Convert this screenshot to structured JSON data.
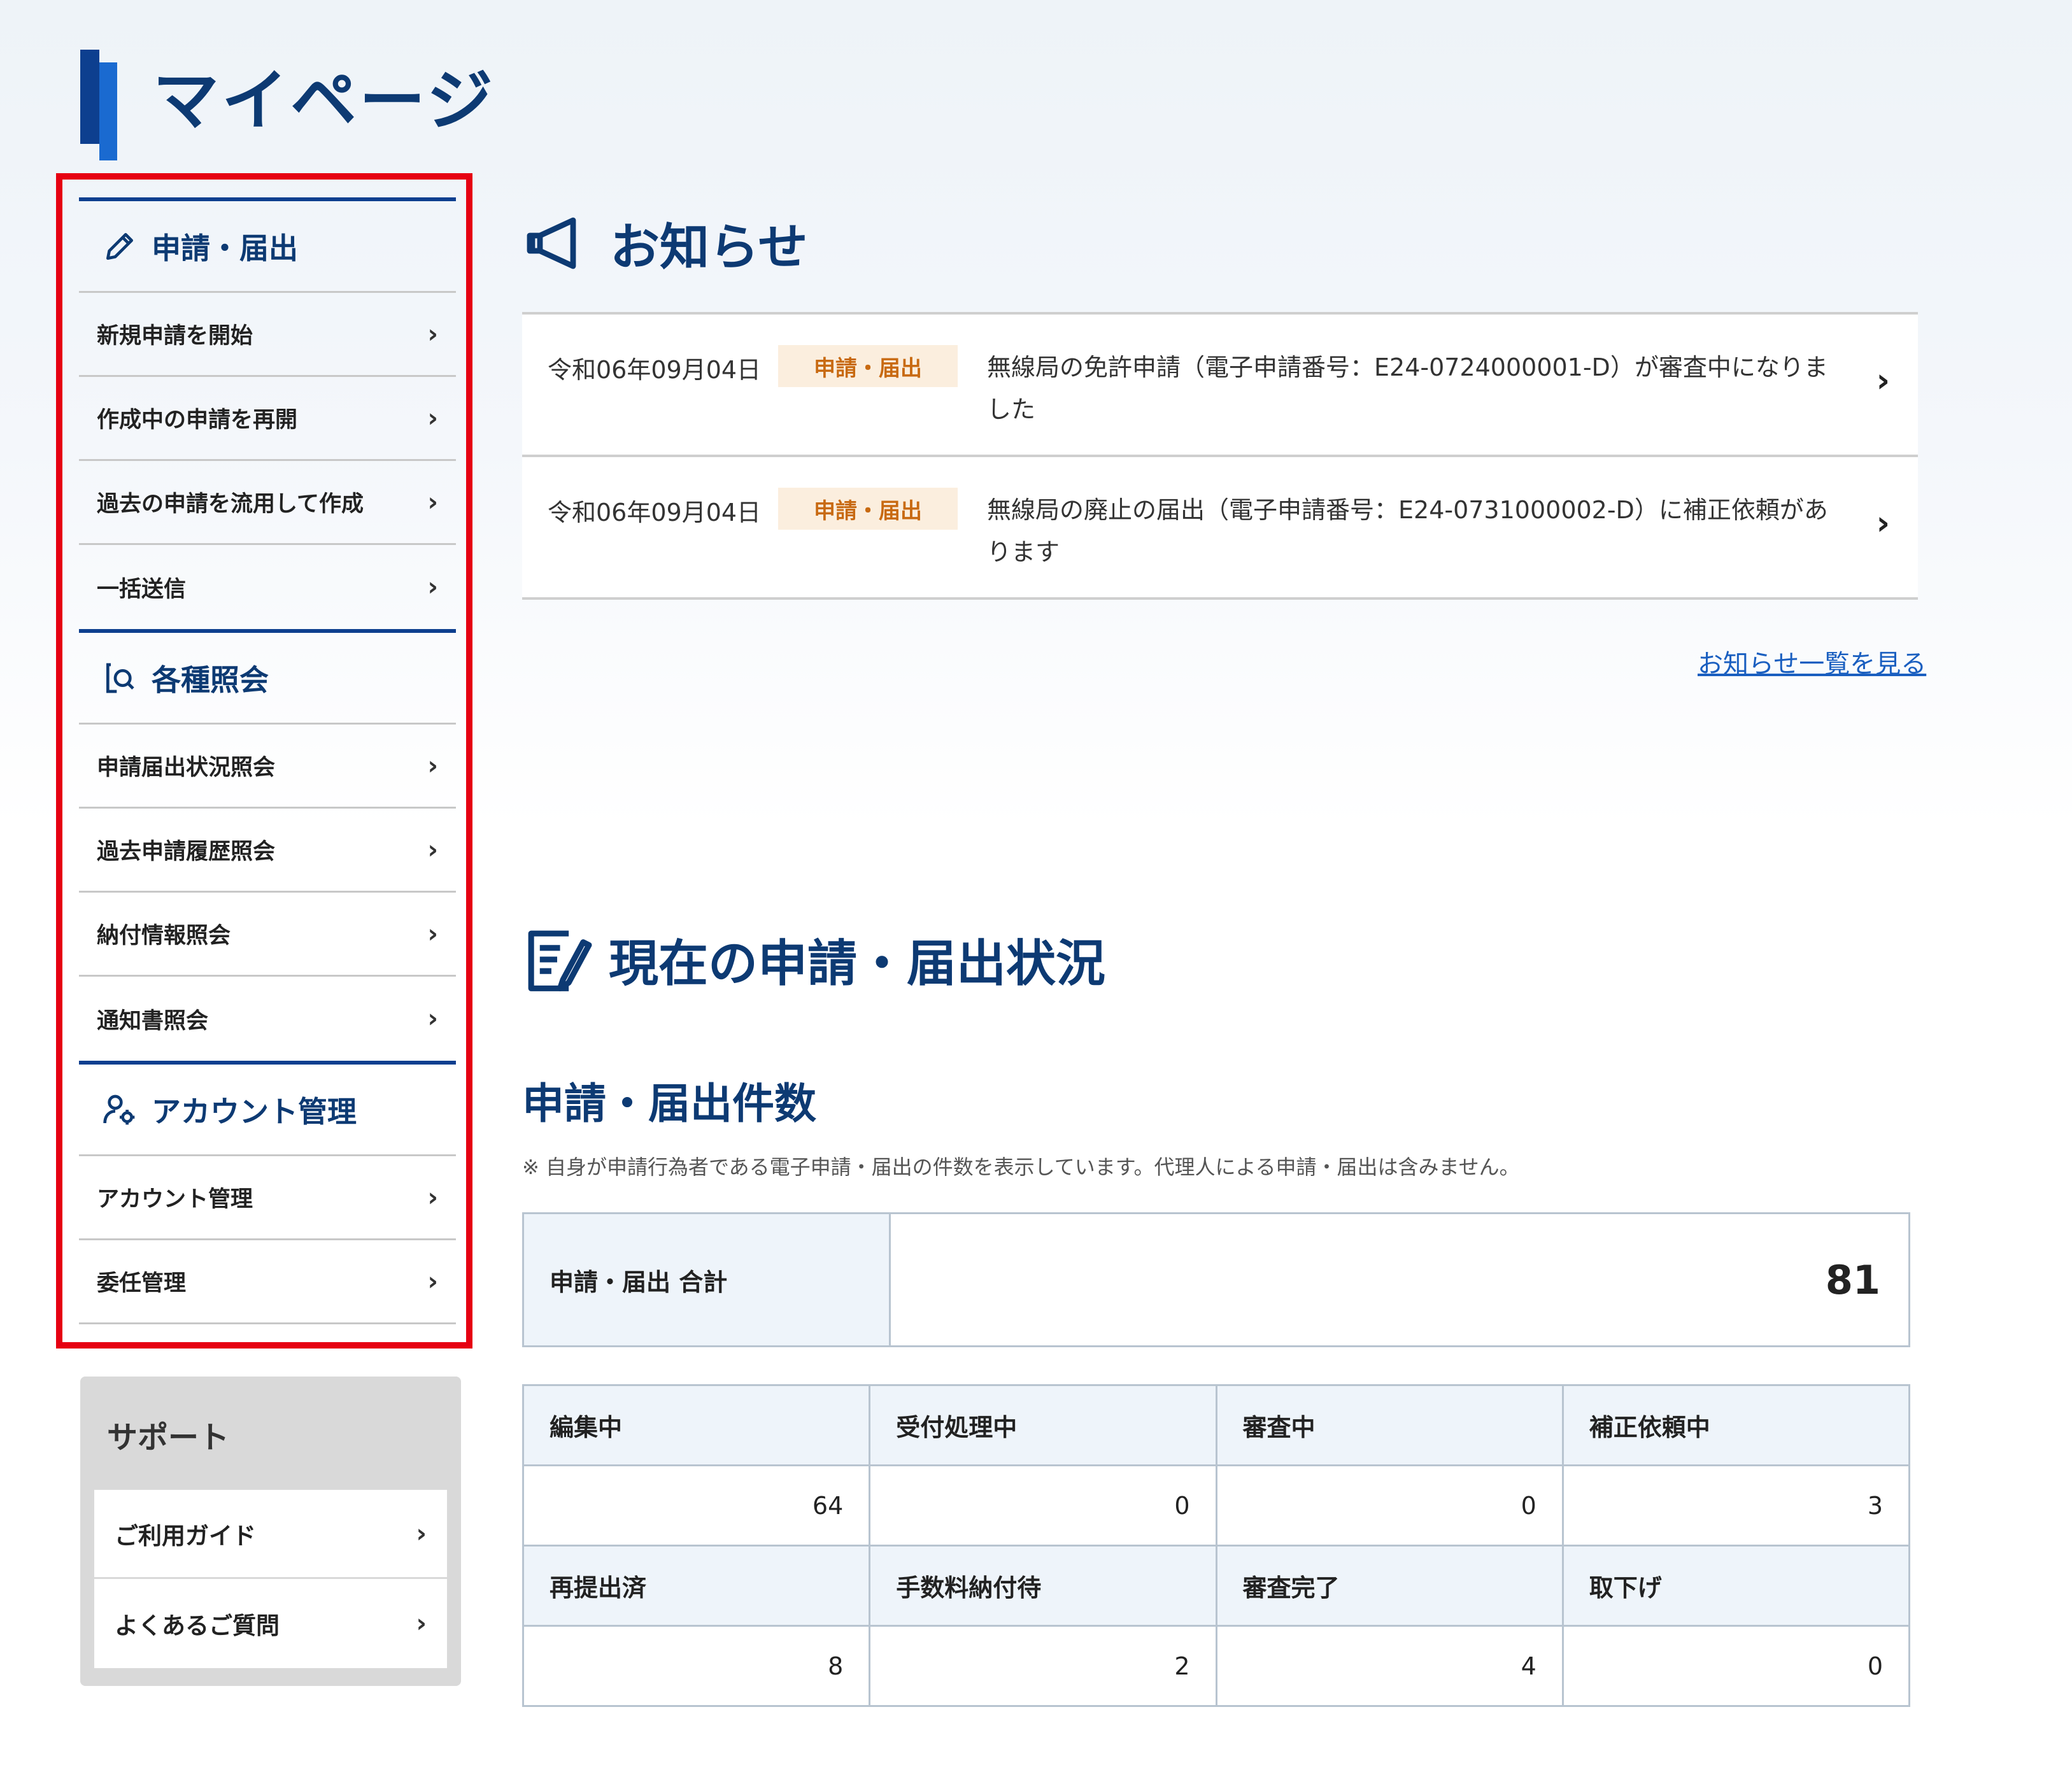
{
  "page": {
    "title": "マイページ"
  },
  "menu": {
    "sections": [
      {
        "title": "申請・届出",
        "icon": "pencil-icon",
        "items": [
          "新規申請を開始",
          "作成中の申請を再開",
          "過去の申請を流用して作成",
          "一括送信"
        ]
      },
      {
        "title": "各種照会",
        "icon": "document-search-icon",
        "items": [
          "申請届出状況照会",
          "過去申請履歴照会",
          "納付情報照会",
          "通知書照会"
        ]
      },
      {
        "title": "アカウント管理",
        "icon": "user-gear-icon",
        "items": [
          "アカウント管理",
          "委任管理"
        ]
      }
    ],
    "highlight_color": "#e60012"
  },
  "support": {
    "title": "サポート",
    "items": [
      "ご利用ガイド",
      "よくあるご質問"
    ]
  },
  "notices": {
    "title": "お知らせ",
    "icon": "megaphone-icon",
    "items": [
      {
        "date": "令和06年09月04日",
        "tag": "申請・届出",
        "text": "無線局の免許申請（電子申請番号：E24-0724000001-D）が審査中になりました"
      },
      {
        "date": "令和06年09月04日",
        "tag": "申請・届出",
        "text": "無線局の廃止の届出（電子申請番号：E24-0731000002-D）に補正依頼があります"
      }
    ],
    "list_link": "お知らせ一覧を見る"
  },
  "status": {
    "title": "現在の申請・届出状況",
    "icon": "checklist-icon",
    "count_title": "申請・届出件数",
    "note": "※ 自身が申請行為者である電子申請・届出の件数を表示しています。代理人による申請・届出は含みません。",
    "total_label": "申請・届出 合計",
    "total_value": "81",
    "row1_labels": [
      "編集中",
      "受付処理中",
      "審査中",
      "補正依頼中"
    ],
    "row1_values": [
      "64",
      "0",
      "0",
      "3"
    ],
    "row2_labels": [
      "再提出済",
      "手数料納付待",
      "審査完了",
      "取下げ"
    ],
    "row2_values": [
      "8",
      "2",
      "4",
      "0"
    ]
  },
  "colors": {
    "primary": "#0d3a73",
    "accent": "#1a6ad0",
    "tag_bg": "#fbeede",
    "tag_text": "#c86a12",
    "link": "#1a5fc0"
  }
}
